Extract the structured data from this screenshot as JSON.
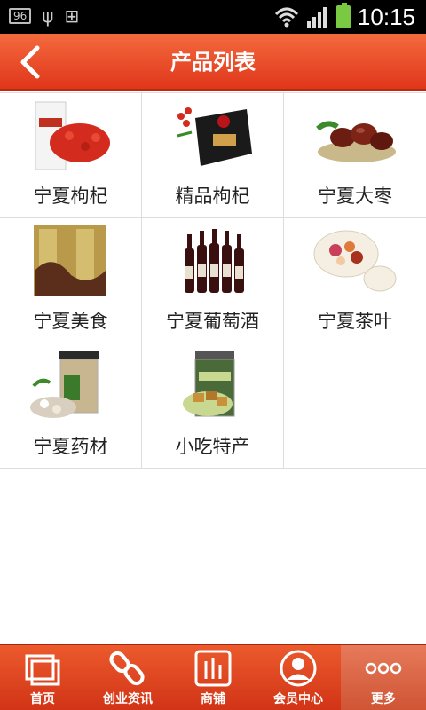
{
  "status_bar": {
    "badge": "96",
    "time": "10:15"
  },
  "header": {
    "title": "产品列表"
  },
  "products": [
    {
      "label": "宁夏枸杞",
      "icon": "goji-berry-bag-icon"
    },
    {
      "label": "精品枸杞",
      "icon": "goji-gift-box-icon"
    },
    {
      "label": "宁夏大枣",
      "icon": "jujube-dates-icon"
    },
    {
      "label": "宁夏美食",
      "icon": "local-food-package-icon"
    },
    {
      "label": "宁夏葡萄酒",
      "icon": "wine-bottles-icon"
    },
    {
      "label": "宁夏茶叶",
      "icon": "tea-cup-icon"
    },
    {
      "label": "宁夏药材",
      "icon": "herb-jar-icon"
    },
    {
      "label": "小吃特产",
      "icon": "snack-jar-icon"
    }
  ],
  "bottom_nav": [
    {
      "label": "首页",
      "icon": "home-icon"
    },
    {
      "label": "创业资讯",
      "icon": "link-icon"
    },
    {
      "label": "商铺",
      "icon": "store-icon"
    },
    {
      "label": "会员中心",
      "icon": "user-icon"
    },
    {
      "label": "更多",
      "icon": "more-icon"
    }
  ],
  "colors": {
    "accent": "#e0361b",
    "battery": "#7ac943"
  }
}
